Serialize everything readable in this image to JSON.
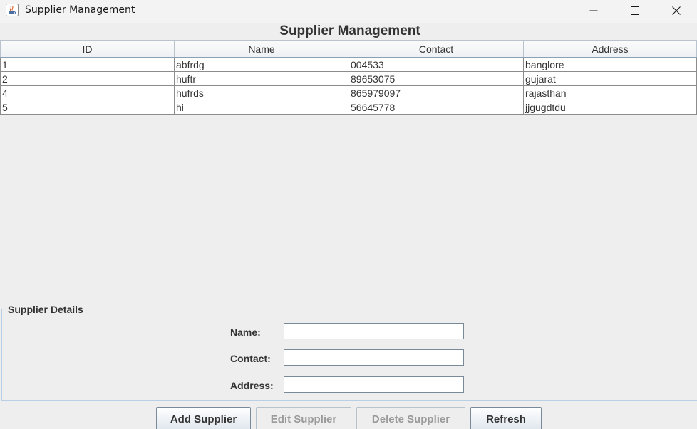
{
  "window": {
    "title": "Supplier Management",
    "icon": "java-coffee-cup-icon"
  },
  "header": {
    "title": "Supplier Management"
  },
  "table": {
    "columns": [
      "ID",
      "Name",
      "Contact",
      "Address"
    ],
    "rows": [
      [
        "1",
        "abfrdg",
        "004533",
        "banglore"
      ],
      [
        "2",
        "huftr",
        "89653075",
        "gujarat"
      ],
      [
        "4",
        "hufrds",
        "865979097",
        "rajasthan"
      ],
      [
        "5",
        "hi",
        "56645778",
        "jjgugdtdu"
      ]
    ]
  },
  "details": {
    "legend": "Supplier Details",
    "name_label": "Name:",
    "name_value": "",
    "contact_label": "Contact:",
    "contact_value": "",
    "address_label": "Address:",
    "address_value": ""
  },
  "buttons": {
    "add_label": "Add Supplier",
    "edit_label": "Edit Supplier",
    "delete_label": "Delete Supplier",
    "refresh_label": "Refresh",
    "edit_enabled": false,
    "delete_enabled": false
  },
  "colors": {
    "panel_border": "#b8cfe5",
    "disabled_text": "#9a9a9a"
  }
}
